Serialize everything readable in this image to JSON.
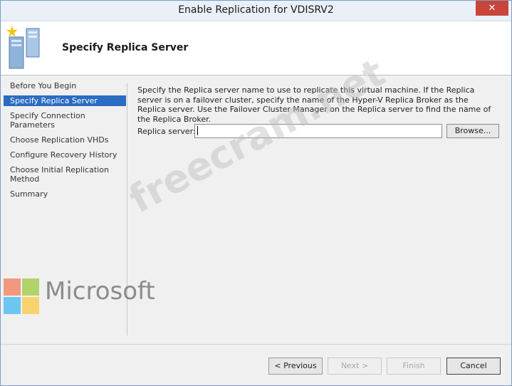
{
  "window": {
    "title": "Enable Replication for VDISRV2",
    "close_glyph": "✕"
  },
  "header": {
    "title": "Specify Replica Server",
    "icon": "replication-wizard-icon"
  },
  "nav": {
    "items": [
      {
        "label": "Before You Begin",
        "active": false
      },
      {
        "label": "Specify Replica Server",
        "active": true
      },
      {
        "label": "Specify Connection\nParameters",
        "active": false
      },
      {
        "label": "Choose Replication VHDs",
        "active": false
      },
      {
        "label": "Configure Recovery History",
        "active": false
      },
      {
        "label": "Choose Initial Replication\nMethod",
        "active": false
      },
      {
        "label": "Summary",
        "active": false
      }
    ]
  },
  "content": {
    "description": "Specify the Replica server name to use to replicate this virtual machine. If the Replica server is on a failover cluster, specify the name of the Hyper-V Replica Broker as the Replica server. Use the Failover Cluster Manager on the Replica server to find the name of the Replica Broker.",
    "replica_label": "Replica server:",
    "replica_value": "",
    "browse_label": "Browse..."
  },
  "footer": {
    "previous_label": "< Previous",
    "next_label": "Next >",
    "finish_label": "Finish",
    "cancel_label": "Cancel"
  },
  "overlay": {
    "logo_text": "Microsoft",
    "watermark_text": "freecram.net"
  },
  "colors": {
    "active_nav": "#2a6cc1",
    "close_button": "#c7453b",
    "logo_red": "#f25022",
    "logo_green": "#7fba00",
    "logo_blue": "#00a4ef",
    "logo_yellow": "#ffb900"
  }
}
